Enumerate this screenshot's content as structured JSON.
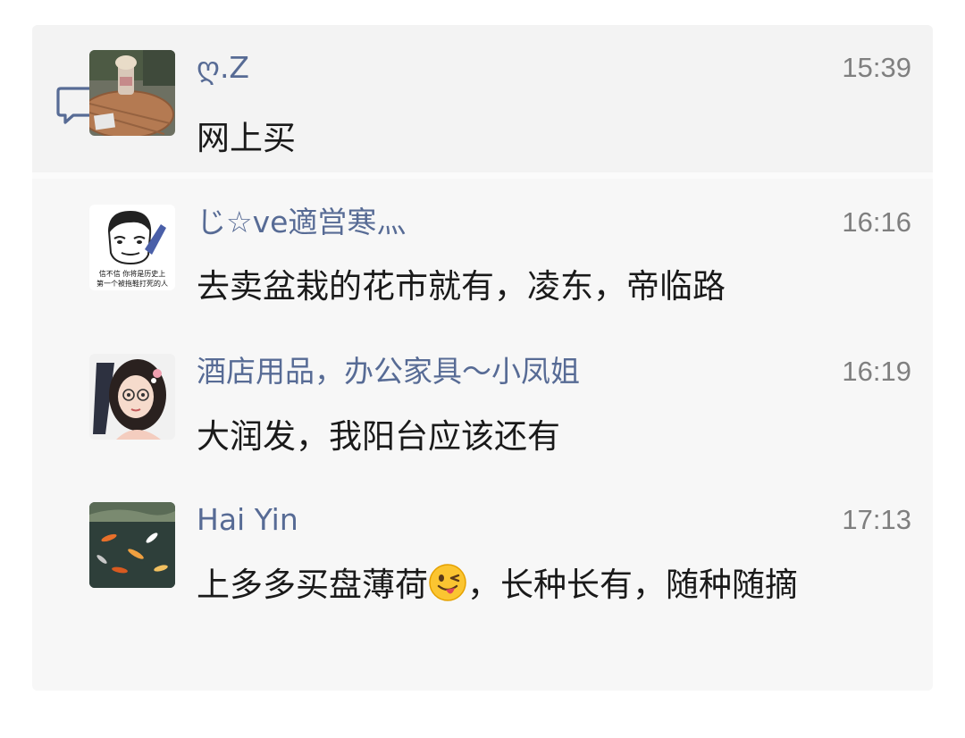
{
  "messages": [
    {
      "name": "ღ.Z",
      "time": "15:39",
      "text": "网上买",
      "avatar": "avatar-coffee-table-photo"
    },
    {
      "name": "じ☆ve適営寒灬",
      "time": "16:16",
      "text": "去卖盆栽的花市就有，凌东，帝临路",
      "avatar": "avatar-meme-face"
    },
    {
      "name": "酒店用品，办公家具～小凤姐",
      "time": "16:19",
      "text": "大润发，我阳台应该还有",
      "avatar": "avatar-cartoon-girl"
    },
    {
      "name": "Hai Yin",
      "time": "17:13",
      "text_before_emoji": "上多多买盘薄荷",
      "emoji": "winking-face-tongue-emoji",
      "text_after_emoji": "，长种长有，随种随摘",
      "avatar": "avatar-koi-pond-photo"
    }
  ],
  "meme_caption": {
    "line1": "信不信 你将是历史上",
    "line2": "第一个被拖鞋打死的人"
  },
  "colors": {
    "name_link": "#576b95",
    "time": "#7f7f7f",
    "panel_bg": "#f7f7f7"
  },
  "icons": {
    "reply": "comment-bubble-icon"
  }
}
